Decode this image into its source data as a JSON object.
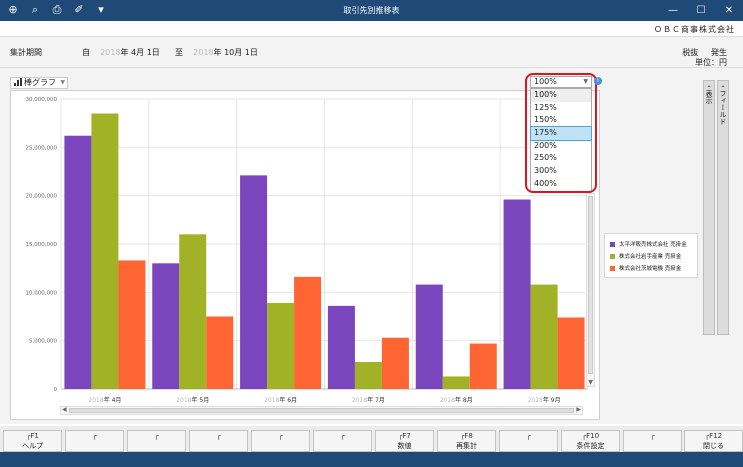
{
  "window": {
    "title": "取引先別推移表"
  },
  "company": "ＯＢＣ商事株式会社",
  "header": {
    "period_label": "集計期間",
    "from_prefix": "自",
    "from_year": "2018",
    "from_suffix": "年  4月 1日",
    "to_prefix": "至",
    "to_year": "2018",
    "to_suffix": "年 10月 1日",
    "tax_label": "税抜",
    "basis_label": "発生",
    "unit_label": "単位：円"
  },
  "graph_type": {
    "selected": "棒グラフ"
  },
  "zoom": {
    "selected": "100%",
    "options": [
      "100%",
      "125%",
      "150%",
      "175%",
      "200%",
      "250%",
      "300%",
      "400%"
    ],
    "highlighted": "175%"
  },
  "side_tabs": {
    "display": "表示",
    "field": "フィールド"
  },
  "chart_data": {
    "type": "bar",
    "categories": [
      "2018年  4月",
      "2018年  5月",
      "2018年  6月",
      "2018年  7月",
      "2018年  8月",
      "2018年  9月"
    ],
    "category_year": "2018",
    "category_months": [
      "年  4月",
      "年  5月",
      "年  6月",
      "年  7月",
      "年  8月",
      "年  9月"
    ],
    "series": [
      {
        "name": "太平洋販売株式会社 売掛金",
        "color": "#7a45bd",
        "values": [
          26200000,
          13000000,
          22100000,
          8600000,
          10800000,
          19600000
        ]
      },
      {
        "name": "株式会社岩手産業 売掛金",
        "color": "#a2b226",
        "values": [
          28500000,
          16000000,
          8900000,
          2800000,
          1300000,
          10800000
        ]
      },
      {
        "name": "株式会社茨城電機 売掛金",
        "color": "#ff6533",
        "values": [
          13300000,
          7500000,
          11600000,
          5300000,
          4700000,
          7400000
        ]
      }
    ],
    "yticks": [
      "0",
      "5,000,000",
      "10,000,000",
      "15,000,000",
      "20,000,000",
      "25,000,000",
      "30,000,000"
    ],
    "ylim": [
      0,
      30000000
    ],
    "grid": true,
    "legend_position": "right"
  },
  "fkeys": [
    {
      "key": "F1",
      "label": "ヘルプ"
    },
    {
      "key": "",
      "label": ""
    },
    {
      "key": "",
      "label": ""
    },
    {
      "key": "",
      "label": ""
    },
    {
      "key": "",
      "label": ""
    },
    {
      "key": "",
      "label": ""
    },
    {
      "key": "F7",
      "label": "数値"
    },
    {
      "key": "F8",
      "label": "再集計"
    },
    {
      "key": "",
      "label": ""
    },
    {
      "key": "F10",
      "label": "条件設定"
    },
    {
      "key": "",
      "label": ""
    },
    {
      "key": "F12",
      "label": "閉じる"
    }
  ]
}
